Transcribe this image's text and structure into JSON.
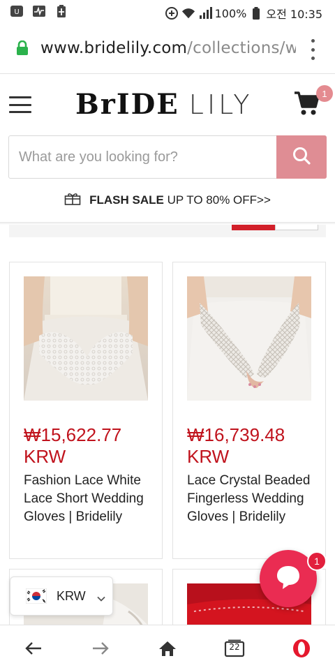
{
  "status_bar": {
    "battery_percent": "100%",
    "clock": "오전 10:35"
  },
  "browser": {
    "url_host": "www.bridelily.com",
    "url_path": "/collections/we",
    "tab_count": "22"
  },
  "header": {
    "logo_bride": "BrIDE",
    "logo_lily": "LILY",
    "cart_count": "1"
  },
  "search": {
    "placeholder": "What are you looking for?"
  },
  "promo": {
    "flash_bold": "FLASH SALE",
    "flash_rest": "UP TO 80% OFF>>"
  },
  "products": [
    {
      "price": "₩15,622.77 KRW",
      "name": "Fashion Lace White Lace Short Wedding Gloves | Bridelily"
    },
    {
      "price": "₩16,739.48 KRW",
      "name": "Lace Crystal Beaded Fingerless Wedding Gloves | Bridelily"
    }
  ],
  "currency": {
    "code": "KRW"
  },
  "chat": {
    "badge": "1"
  },
  "colors": {
    "price_red": "#c0131d",
    "search_button": "#df8d94",
    "chat_pink": "#ea2c52"
  }
}
